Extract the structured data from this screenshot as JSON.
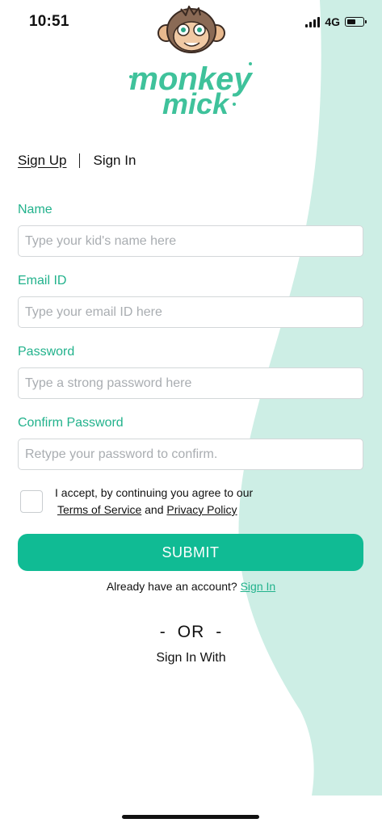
{
  "status_bar": {
    "time": "10:51",
    "network": "4G"
  },
  "logo": {
    "line1": "monkey",
    "line2": "mick",
    "brand_color": "#3fc29b"
  },
  "auth_tabs": {
    "sign_up": "Sign Up",
    "sign_in": "Sign In"
  },
  "form": {
    "fields": [
      {
        "label": "Name",
        "placeholder": "Type your kid's name here"
      },
      {
        "label": "Email ID",
        "placeholder": "Type your email ID here"
      },
      {
        "label": "Password",
        "placeholder": "Type a strong password here"
      },
      {
        "label": "Confirm Password",
        "placeholder": "Retype your password to confirm."
      }
    ],
    "terms_prefix": "I accept, by continuing you agree to our",
    "terms_of_service": "Terms of Service",
    "and_text": "and",
    "privacy_policy": "Privacy Policy",
    "terms_checked": false,
    "submit_label": "SUBMIT"
  },
  "footer": {
    "already_text": "Already have an account?",
    "sign_in_link": "Sign In",
    "or_dash": "-",
    "or_text": "OR",
    "sign_in_with": "Sign In With"
  },
  "colors": {
    "accent": "#10bb94",
    "label_green": "#22b28c",
    "wave_mint": "#cdeee5"
  }
}
